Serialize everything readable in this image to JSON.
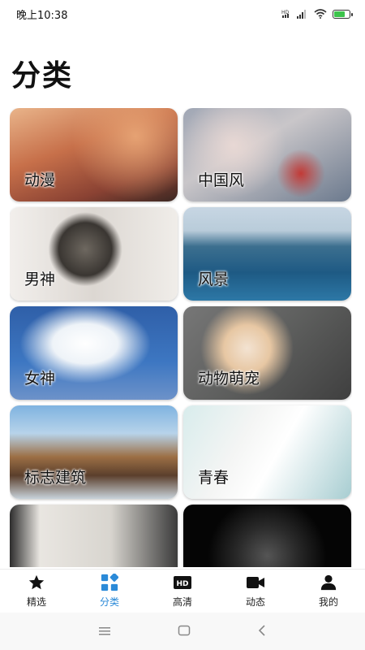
{
  "status_bar": {
    "time": "晚上10:38",
    "battery_level": 0.7,
    "icons": [
      "hd-icon",
      "signal-icon",
      "wifi-icon",
      "battery-icon"
    ]
  },
  "page": {
    "title": "分类"
  },
  "categories": [
    {
      "label": "动漫"
    },
    {
      "label": "中国风"
    },
    {
      "label": "男神"
    },
    {
      "label": "风景"
    },
    {
      "label": "女神"
    },
    {
      "label": "动物萌宠"
    },
    {
      "label": "标志建筑"
    },
    {
      "label": "青春"
    },
    {
      "label": ""
    },
    {
      "label": ""
    }
  ],
  "bottom_nav": {
    "items": [
      {
        "label": "精选",
        "icon": "star-icon"
      },
      {
        "label": "分类",
        "icon": "grid-icon",
        "active": true
      },
      {
        "label": "高清",
        "icon": "hd-icon"
      },
      {
        "label": "动态",
        "icon": "video-camera-icon"
      },
      {
        "label": "我的",
        "icon": "user-icon"
      }
    ]
  },
  "colors": {
    "accent": "#2b8ad8",
    "battery": "#3cc44b"
  }
}
